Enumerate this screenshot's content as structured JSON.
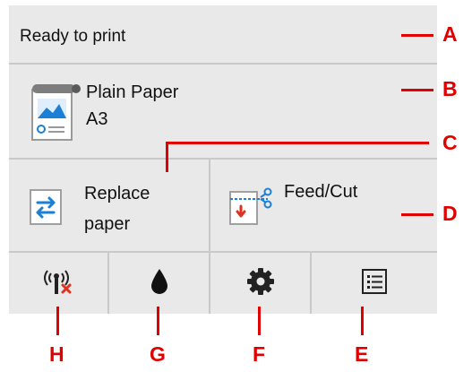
{
  "status": {
    "text": "Ready to print"
  },
  "media": {
    "icon": "paper-roll-icon",
    "type": "Plain Paper",
    "size": "A3"
  },
  "buttons": {
    "replace": {
      "label_line1": "Replace",
      "label_line2": "paper",
      "icon": "replace-paper-icon"
    },
    "feedcut": {
      "label": "Feed/Cut",
      "icon": "feed-cut-icon"
    }
  },
  "bottom_bar": [
    {
      "name": "wireless-status",
      "icon": "wireless-disconnected-icon"
    },
    {
      "name": "ink",
      "icon": "ink-drop-icon"
    },
    {
      "name": "settings",
      "icon": "gear-icon"
    },
    {
      "name": "menu",
      "icon": "list-menu-icon"
    }
  ],
  "callouts": {
    "A": "A",
    "B": "B",
    "C": "C",
    "D": "D",
    "E": "E",
    "F": "F",
    "G": "G",
    "H": "H"
  },
  "colors": {
    "panel_bg": "#e9e9e9",
    "divider": "#c9c9c9",
    "callout": "#e00000",
    "icon_blue": "#1c7fd6",
    "icon_red": "#e0301e"
  }
}
